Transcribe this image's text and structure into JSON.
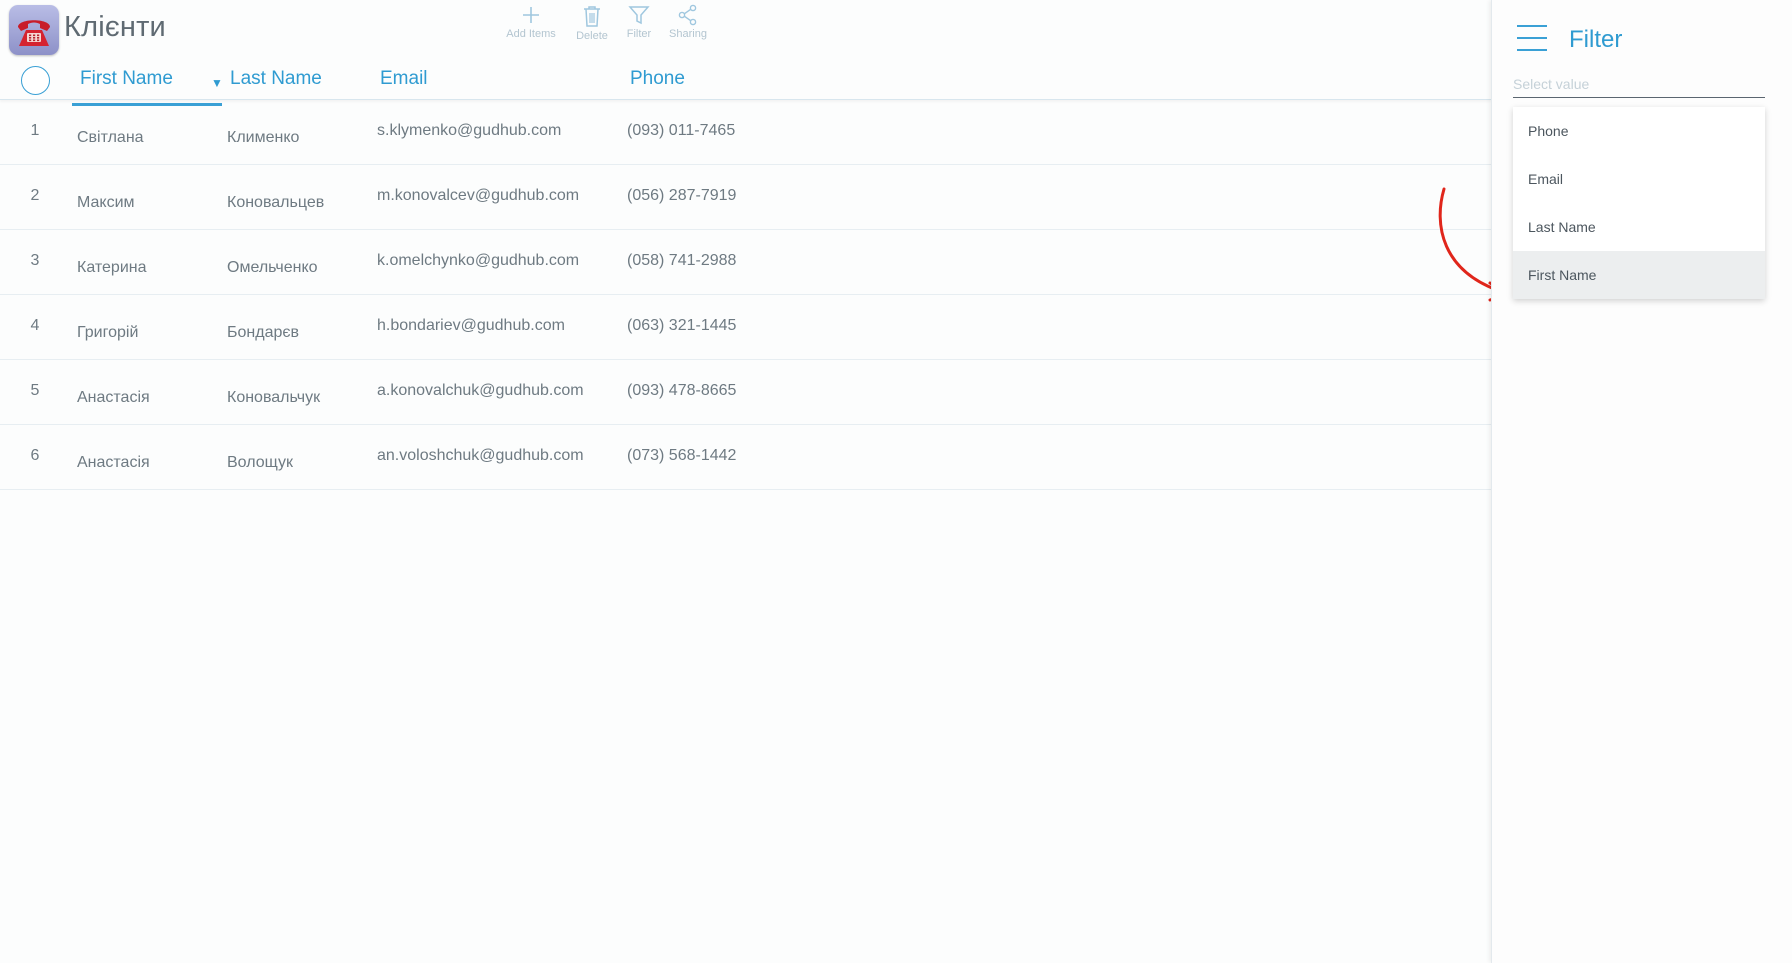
{
  "header": {
    "title": "Клієнти",
    "app_icon": "telephone-icon"
  },
  "toolbar": [
    {
      "id": "add",
      "label": "Add Items",
      "icon": "plus-icon"
    },
    {
      "id": "delete",
      "label": "Delete",
      "icon": "trash-icon"
    },
    {
      "id": "filter",
      "label": "Filter",
      "icon": "funnel-icon"
    },
    {
      "id": "sharing",
      "label": "Sharing",
      "icon": "share-icon"
    }
  ],
  "table": {
    "columns": {
      "first_name": "First Name",
      "last_name": "Last Name",
      "email": "Email",
      "phone": "Phone"
    },
    "sorted_by": "First Name",
    "rows": [
      {
        "num": "1",
        "first_name": "Світлана",
        "last_name": "Клименко",
        "email": "s.klymenko@gudhub.com",
        "phone": "(093) 011-7465"
      },
      {
        "num": "2",
        "first_name": "Максим",
        "last_name": "Коновальцев",
        "email": "m.konovalcev@gudhub.com",
        "phone": "(056) 287-7919"
      },
      {
        "num": "3",
        "first_name": "Катерина",
        "last_name": "Омельченко",
        "email": "k.omelchynko@gudhub.com",
        "phone": "(058) 741-2988"
      },
      {
        "num": "4",
        "first_name": "Григорій",
        "last_name": "Бондарєв",
        "email": "h.bondariev@gudhub.com",
        "phone": "(063) 321-1445"
      },
      {
        "num": "5",
        "first_name": "Анастасія",
        "last_name": "Коновальчук",
        "email": "a.konovalchuk@gudhub.com",
        "phone": "(093) 478-8665"
      },
      {
        "num": "6",
        "first_name": "Анастасія",
        "last_name": "Волощук",
        "email": "an.voloshchuk@gudhub.com",
        "phone": "(073) 568-1442"
      }
    ]
  },
  "filter_panel": {
    "title": "Filter",
    "select_placeholder": "Select value",
    "options": [
      "Phone",
      "Email",
      "Last Name",
      "First Name"
    ],
    "highlighted_option": "First Name"
  },
  "colors": {
    "accent": "#3aa0d5",
    "annotation_arrow": "#e0261b"
  }
}
